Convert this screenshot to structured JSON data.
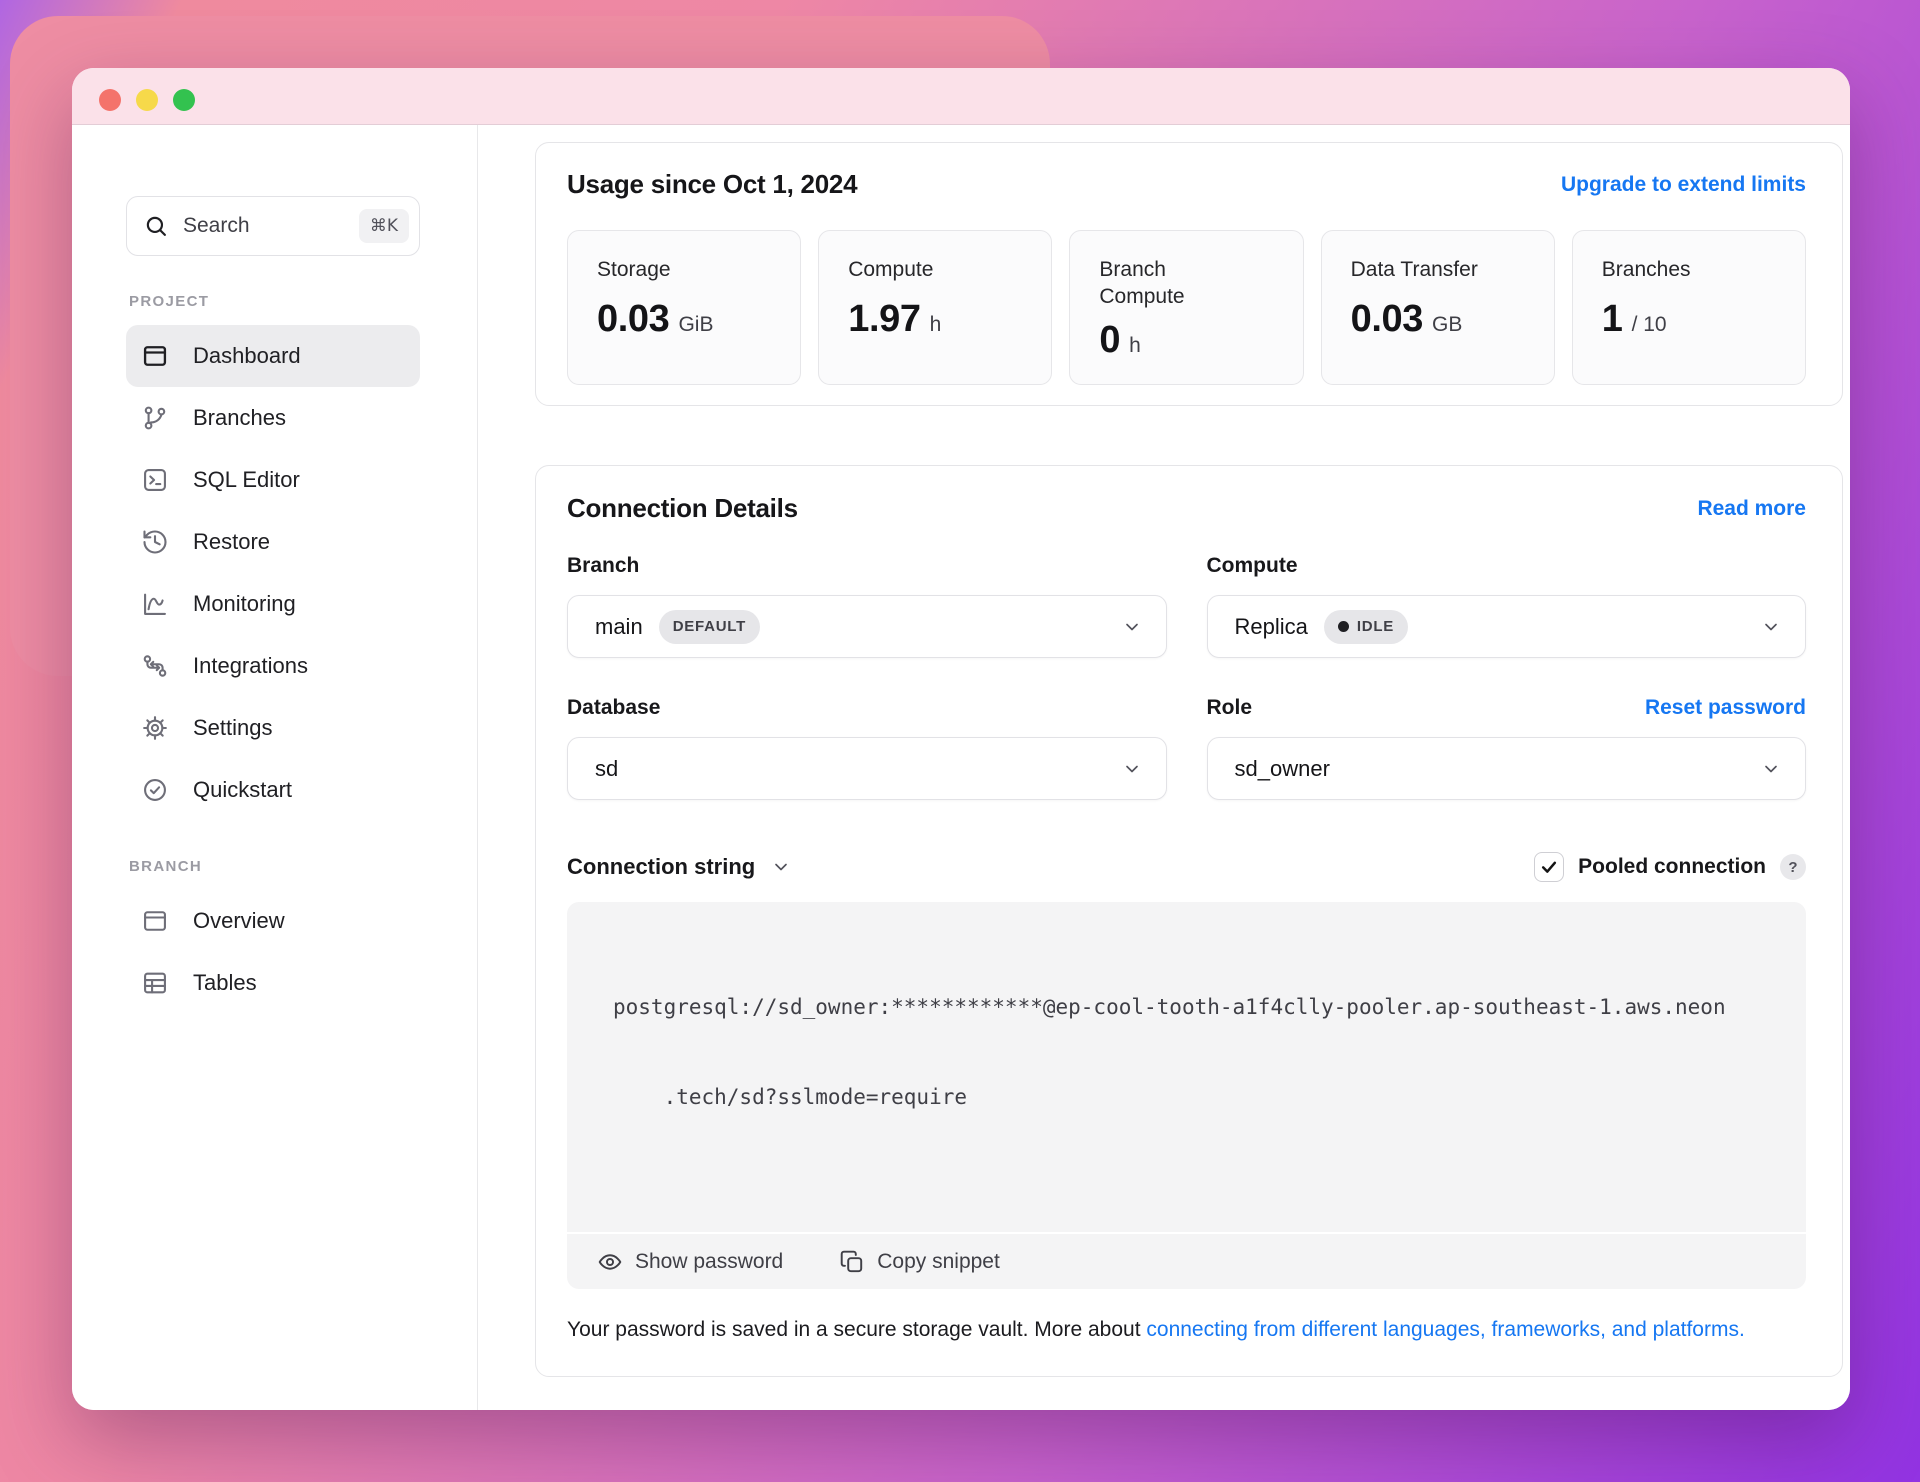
{
  "colors": {
    "accent_blue": "#1677f2",
    "titlebar_pink": "#fbe1e9",
    "traffic_red": "#f4736b",
    "traffic_yellow": "#f6d94a",
    "traffic_green": "#33c24f",
    "idle_dot": "#1f1f23",
    "background_gradient_start": "#ef8a9e",
    "background_gradient_end": "#9233e2"
  },
  "sidebar": {
    "search": {
      "label": "Search",
      "shortcut": "⌘K"
    },
    "sections": [
      {
        "label": "PROJECT",
        "items": [
          {
            "label": "Dashboard"
          },
          {
            "label": "Branches"
          },
          {
            "label": "SQL Editor"
          },
          {
            "label": "Restore"
          },
          {
            "label": "Monitoring"
          },
          {
            "label": "Integrations"
          },
          {
            "label": "Settings"
          },
          {
            "label": "Quickstart"
          }
        ]
      },
      {
        "label": "BRANCH",
        "items": [
          {
            "label": "Overview"
          },
          {
            "label": "Tables"
          }
        ]
      }
    ]
  },
  "usage": {
    "title": "Usage since Oct 1, 2024",
    "upgrade_link": "Upgrade to extend limits",
    "stats": [
      {
        "label": "Storage",
        "value": "0.03",
        "unit": "GiB"
      },
      {
        "label": "Compute",
        "value": "1.97",
        "unit": "h"
      },
      {
        "label": "Branch Compute",
        "value": "0",
        "unit": "h"
      },
      {
        "label": "Data Transfer",
        "value": "0.03",
        "unit": "GB"
      },
      {
        "label": "Branches",
        "value": "1",
        "unit": "/ 10"
      }
    ]
  },
  "connection": {
    "title": "Connection Details",
    "read_more": "Read more",
    "branch": {
      "label": "Branch",
      "value": "main",
      "badge": "DEFAULT"
    },
    "compute": {
      "label": "Compute",
      "value": "Replica",
      "badge": "IDLE"
    },
    "database": {
      "label": "Database",
      "value": "sd"
    },
    "role": {
      "label": "Role",
      "value": "sd_owner",
      "reset_link": "Reset password"
    },
    "string_label": "Connection string",
    "pooled_label": "Pooled connection",
    "help": "?",
    "code_line1": "postgresql://sd_owner:************@ep-cool-tooth-a1f4clly-pooler.ap-southeast-1.aws.neon",
    "code_line2": "    .tech/sd?sslmode=require",
    "show_password": "Show password",
    "copy_snippet": "Copy snippet",
    "footer_text": "Your password is saved in a secure storage vault. More about ",
    "footer_link": "connecting from different languages, frameworks, and platforms."
  }
}
